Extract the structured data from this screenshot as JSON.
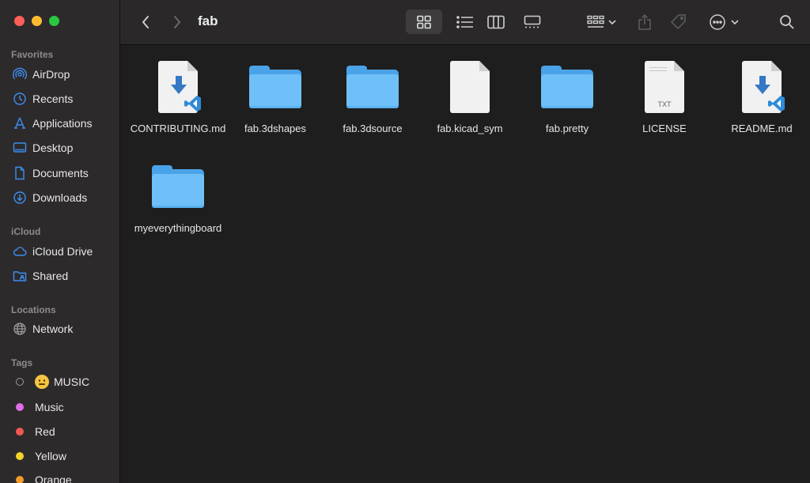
{
  "window": {
    "title": "fab"
  },
  "sidebar": {
    "sections": {
      "favorites": "Favorites",
      "icloud": "iCloud",
      "locations": "Locations",
      "tags": "Tags"
    },
    "favorites": [
      {
        "label": "AirDrop",
        "icon": "airdrop-icon"
      },
      {
        "label": "Recents",
        "icon": "clock-icon"
      },
      {
        "label": "Applications",
        "icon": "applications-icon"
      },
      {
        "label": "Desktop",
        "icon": "desktop-icon"
      },
      {
        "label": "Documents",
        "icon": "document-icon"
      },
      {
        "label": "Downloads",
        "icon": "download-icon"
      }
    ],
    "icloud": [
      {
        "label": "iCloud Drive",
        "icon": "cloud-icon"
      },
      {
        "label": "Shared",
        "icon": "shared-folder-icon"
      }
    ],
    "locations": [
      {
        "label": "Network",
        "icon": "globe-icon"
      }
    ],
    "tags": [
      {
        "label": "MUSIC",
        "color": "#9a9a9a",
        "emoji": "neutral-face-emoji"
      },
      {
        "label": "Music",
        "color": "#e06ee6"
      },
      {
        "label": "Red",
        "color": "#f0584f"
      },
      {
        "label": "Yellow",
        "color": "#f5d22c"
      },
      {
        "label": "Orange",
        "color": "#f59b2c"
      }
    ]
  },
  "files": [
    {
      "name": "CONTRIBUTING.md",
      "kind": "vscode-md"
    },
    {
      "name": "fab.3dshapes",
      "kind": "folder"
    },
    {
      "name": "fab.3dsource",
      "kind": "folder"
    },
    {
      "name": "fab.kicad_sym",
      "kind": "doc"
    },
    {
      "name": "fab.pretty",
      "kind": "folder"
    },
    {
      "name": "LICENSE",
      "kind": "txt",
      "badge": "TXT"
    },
    {
      "name": "README.md",
      "kind": "vscode-md"
    },
    {
      "name": "myeverythingboard",
      "kind": "folder"
    }
  ],
  "colors": {
    "accent": "#3d8ef0",
    "folder": "#6fc0f8"
  }
}
